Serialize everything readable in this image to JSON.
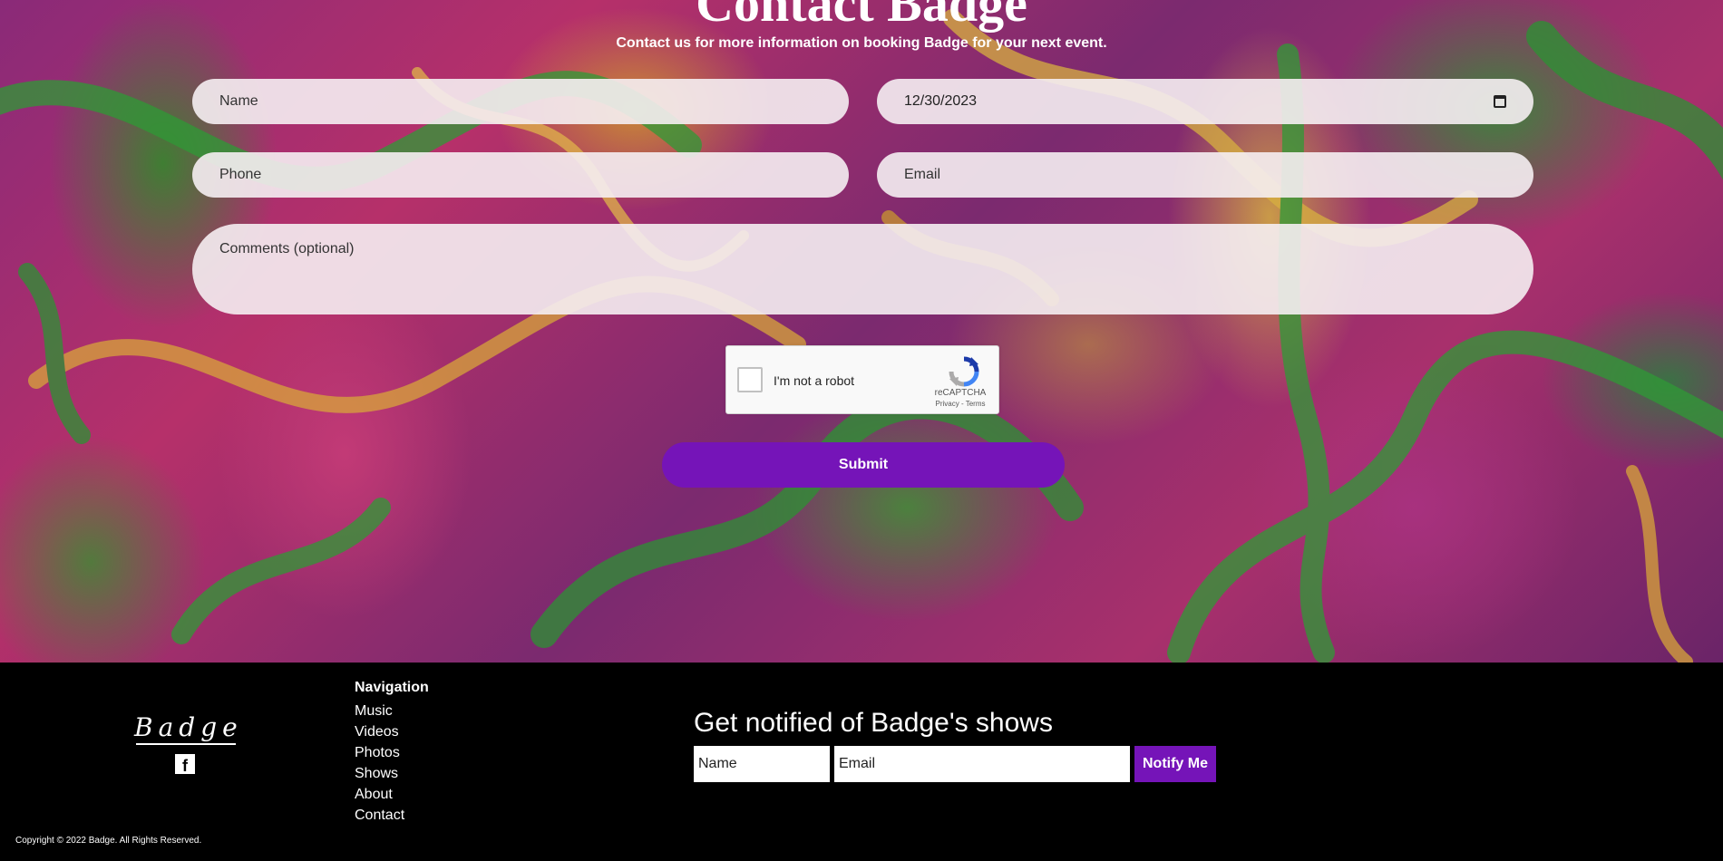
{
  "contact": {
    "title": "Contact Badge",
    "subtitle": "Contact us for more information on booking Badge for your next event.",
    "name_placeholder": "Name",
    "date_value": "12/30/2023",
    "phone_placeholder": "Phone",
    "email_placeholder": "Email",
    "comments_placeholder": "Comments (optional)",
    "submit_label": "Submit"
  },
  "recaptcha": {
    "label": "I'm not a robot",
    "brand": "reCAPTCHA",
    "terms": "Privacy - Terms"
  },
  "footer": {
    "logo_text": "Badge",
    "facebook_icon": "f",
    "nav_heading": "Navigation",
    "nav_items": [
      "Music",
      "Videos",
      "Photos",
      "Shows",
      "About",
      "Contact"
    ],
    "notify_title": "Get notified of Badge's shows",
    "notify_name_placeholder": "Name",
    "notify_email_placeholder": "Email",
    "notify_button": "Notify Me",
    "copyright": "Copyright © 2022 Badge. All Rights Reserved."
  },
  "colors": {
    "accent": "#7514b8",
    "footer_bg": "#000000",
    "field_bg": "#f5eef2"
  }
}
